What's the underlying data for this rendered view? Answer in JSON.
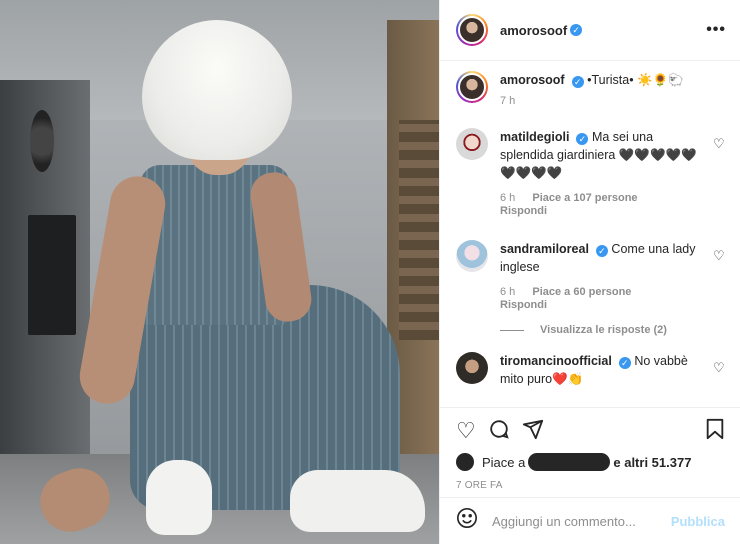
{
  "post": {
    "owner": "amorosoof",
    "caption_text": "•Turista• ☀️🌻🐑",
    "caption_age": "7 h"
  },
  "comments": [
    {
      "user": "matildegioli",
      "text": "Ma sei una splendida giardiniera 🖤🖤🖤🖤🖤🖤🖤🖤🖤",
      "age": "6 h",
      "likes": "Piace a 107 persone",
      "reply": "Rispondi"
    },
    {
      "user": "sandramiloreal",
      "text": "Come una lady inglese",
      "age": "6 h",
      "likes": "Piace a 60 persone",
      "reply": "Rispondi"
    },
    {
      "user": "tiromancinoofficial",
      "text": "No vabbè mito puro❤️👏"
    }
  ],
  "view_replies": "Visualizza le risposte (2)",
  "likes_bar": {
    "prefix": "Piace a",
    "suffix": "e altri 51.377"
  },
  "timestamp": "7 ORE FA",
  "composer": {
    "placeholder": "Aggiungi un commento...",
    "publish": "Pubblica"
  },
  "icons": {
    "more": "more-options-icon",
    "like": "heart-icon",
    "comment": "comment-icon",
    "share": "paper-plane-icon",
    "save": "bookmark-icon",
    "emoji": "smiley-icon",
    "verified": "verified-badge-icon"
  },
  "colors": {
    "verified": "#3897f0",
    "publish_disabled": "#b2dffc",
    "muted_text": "#8e8e8e"
  }
}
